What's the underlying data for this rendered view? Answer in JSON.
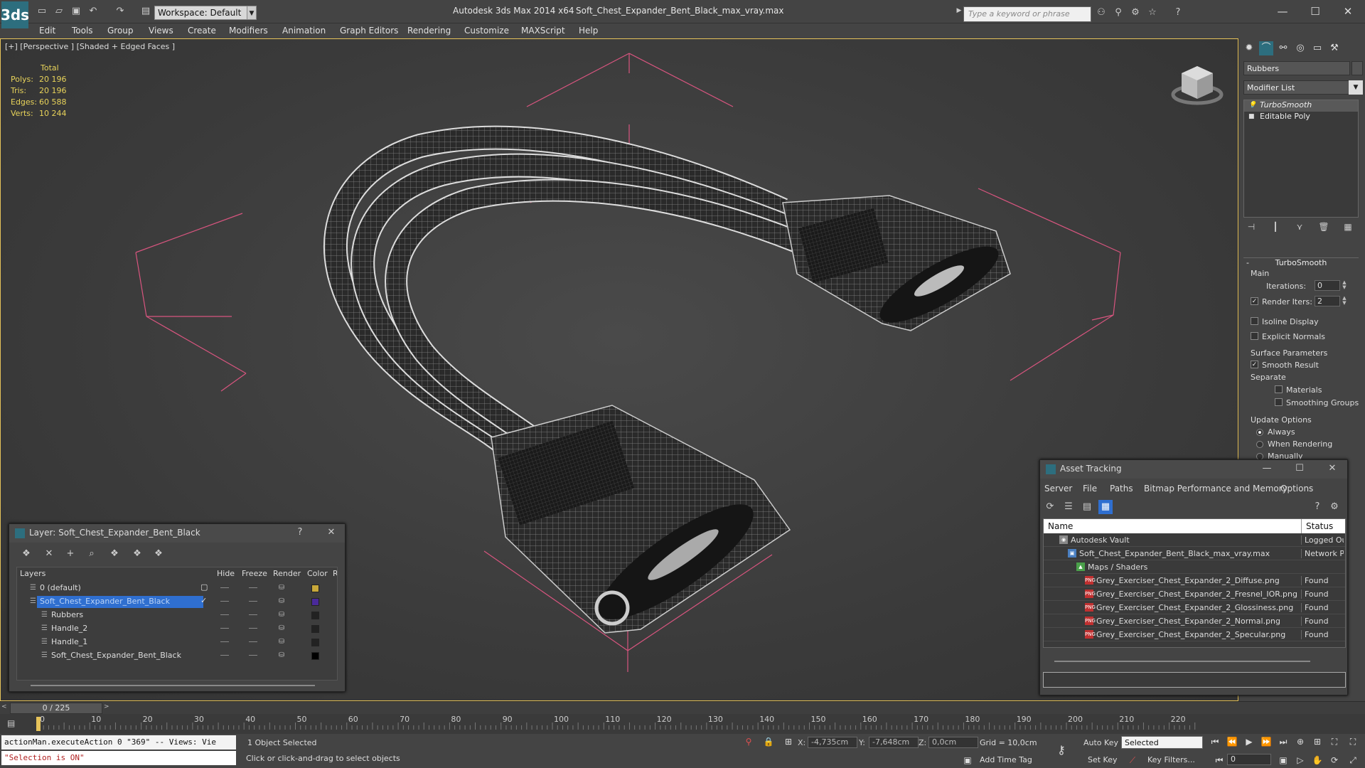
{
  "titlebar": {
    "logo": "3ds",
    "workspace": "Workspace: Default",
    "app_title": "Autodesk 3ds Max  2014 x64",
    "file_title": "Soft_Chest_Expander_Bent_Black_max_vray.max",
    "search_placeholder": "Type a keyword or phrase"
  },
  "menu": [
    "Edit",
    "Tools",
    "Group",
    "Views",
    "Create",
    "Modifiers",
    "Animation",
    "Graph Editors",
    "Rendering",
    "Customize",
    "MAXScript",
    "Help"
  ],
  "viewport": {
    "label": "[+] [Perspective ] [Shaded + Edged Faces ]",
    "stats": {
      "header": "Total",
      "rows": [
        {
          "k": "Polys:",
          "v": "20 196"
        },
        {
          "k": "Tris:",
          "v": "20 196"
        },
        {
          "k": "Edges:",
          "v": "60 588"
        },
        {
          "k": "Verts:",
          "v": "10 244"
        }
      ]
    }
  },
  "command_panel": {
    "object_name": "Rubbers",
    "modifier_list": "Modifier List",
    "stack": [
      {
        "label": "TurboSmooth",
        "active": true
      },
      {
        "label": "Editable Poly",
        "active": false
      }
    ],
    "rollout_title": "TurboSmooth",
    "main_group": "Main",
    "iterations_label": "Iterations:",
    "iterations_value": "0",
    "render_iters_label": "Render Iters:",
    "render_iters_value": "2",
    "isoline": "Isoline Display",
    "explicit_normals": "Explicit Normals",
    "surface_params": "Surface Parameters",
    "smooth_result": "Smooth Result",
    "separate": "Separate",
    "materials": "Materials",
    "smoothing_groups": "Smoothing Groups",
    "update_options": "Update Options",
    "always": "Always",
    "when_rendering": "When Rendering",
    "manually": "Manually"
  },
  "layer_dialog": {
    "title": "Layer: Soft_Chest_Expander_Bent_Black",
    "help": "?",
    "headers": {
      "layers": "Layers",
      "hide": "Hide",
      "freeze": "Freeze",
      "render": "Render",
      "color": "Color",
      "ra": "Ra"
    },
    "rows": [
      {
        "name": "0 (default)",
        "indent": 1,
        "selected": false,
        "color": "#c8a83a"
      },
      {
        "name": "Soft_Chest_Expander_Bent_Black",
        "indent": 1,
        "selected": true,
        "color": "#4a2a9a"
      },
      {
        "name": "Rubbers",
        "indent": 2,
        "selected": false,
        "color": "#222222"
      },
      {
        "name": "Handle_2",
        "indent": 2,
        "selected": false,
        "color": "#222222"
      },
      {
        "name": "Handle_1",
        "indent": 2,
        "selected": false,
        "color": "#222222"
      },
      {
        "name": "Soft_Chest_Expander_Bent_Black",
        "indent": 2,
        "selected": false,
        "color": "#000000"
      }
    ]
  },
  "asset_dialog": {
    "title": "Asset Tracking",
    "menu": [
      "Server",
      "File",
      "Paths",
      "Bitmap Performance and Memory",
      "Options"
    ],
    "col_name": "Name",
    "col_status": "Status",
    "rows": [
      {
        "name": "Autodesk Vault",
        "status": "Logged Ou",
        "level": 1,
        "icon": "vault"
      },
      {
        "name": "Soft_Chest_Expander_Bent_Black_max_vray.max",
        "status": "Network Pa",
        "level": 2,
        "icon": "max"
      },
      {
        "name": "Maps / Shaders",
        "status": "",
        "level": 3,
        "icon": "maps"
      },
      {
        "name": "Grey_Exerciser_Chest_Expander_2_Diffuse.png",
        "status": "Found",
        "level": 4,
        "icon": "png"
      },
      {
        "name": "Grey_Exerciser_Chest_Expander_2_Fresnel_IOR.png",
        "status": "Found",
        "level": 4,
        "icon": "png"
      },
      {
        "name": "Grey_Exerciser_Chest_Expander_2_Glossiness.png",
        "status": "Found",
        "level": 4,
        "icon": "png"
      },
      {
        "name": "Grey_Exerciser_Chest_Expander_2_Normal.png",
        "status": "Found",
        "level": 4,
        "icon": "png"
      },
      {
        "name": "Grey_Exerciser_Chest_Expander_2_Specular.png",
        "status": "Found",
        "level": 4,
        "icon": "png"
      }
    ]
  },
  "timeline": {
    "frame_display": "0 / 225",
    "tick_labels": [
      "0",
      "10",
      "20",
      "30",
      "40",
      "50",
      "60",
      "70",
      "80",
      "90",
      "100",
      "110",
      "120",
      "130",
      "140",
      "150",
      "160",
      "170",
      "180",
      "190",
      "200",
      "210",
      "220"
    ]
  },
  "status": {
    "listener_1": "actionMan.executeAction 0 \"369\"  -- Views: Vie",
    "listener_2": "\"Selection is ON\"",
    "selection": "1 Object Selected",
    "prompt": "Click or click-and-drag to select objects",
    "x_label": "X:",
    "x": "-4,735cm",
    "y_label": "Y:",
    "y": "-7,648cm",
    "z_label": "Z:",
    "z": "0,0cm",
    "grid": "Grid = 10,0cm",
    "add_time_tag": "Add Time Tag",
    "auto_key": "Auto Key",
    "set_key": "Set Key",
    "selected_dd": "Selected",
    "key_filters": "Key Filters...",
    "frame": "0"
  },
  "colors": {
    "accent_selected": "#2f6fd0",
    "viewport_border": "#e6c35a",
    "stats_text": "#e8d35a",
    "bounding_lines": "#d8557f"
  }
}
